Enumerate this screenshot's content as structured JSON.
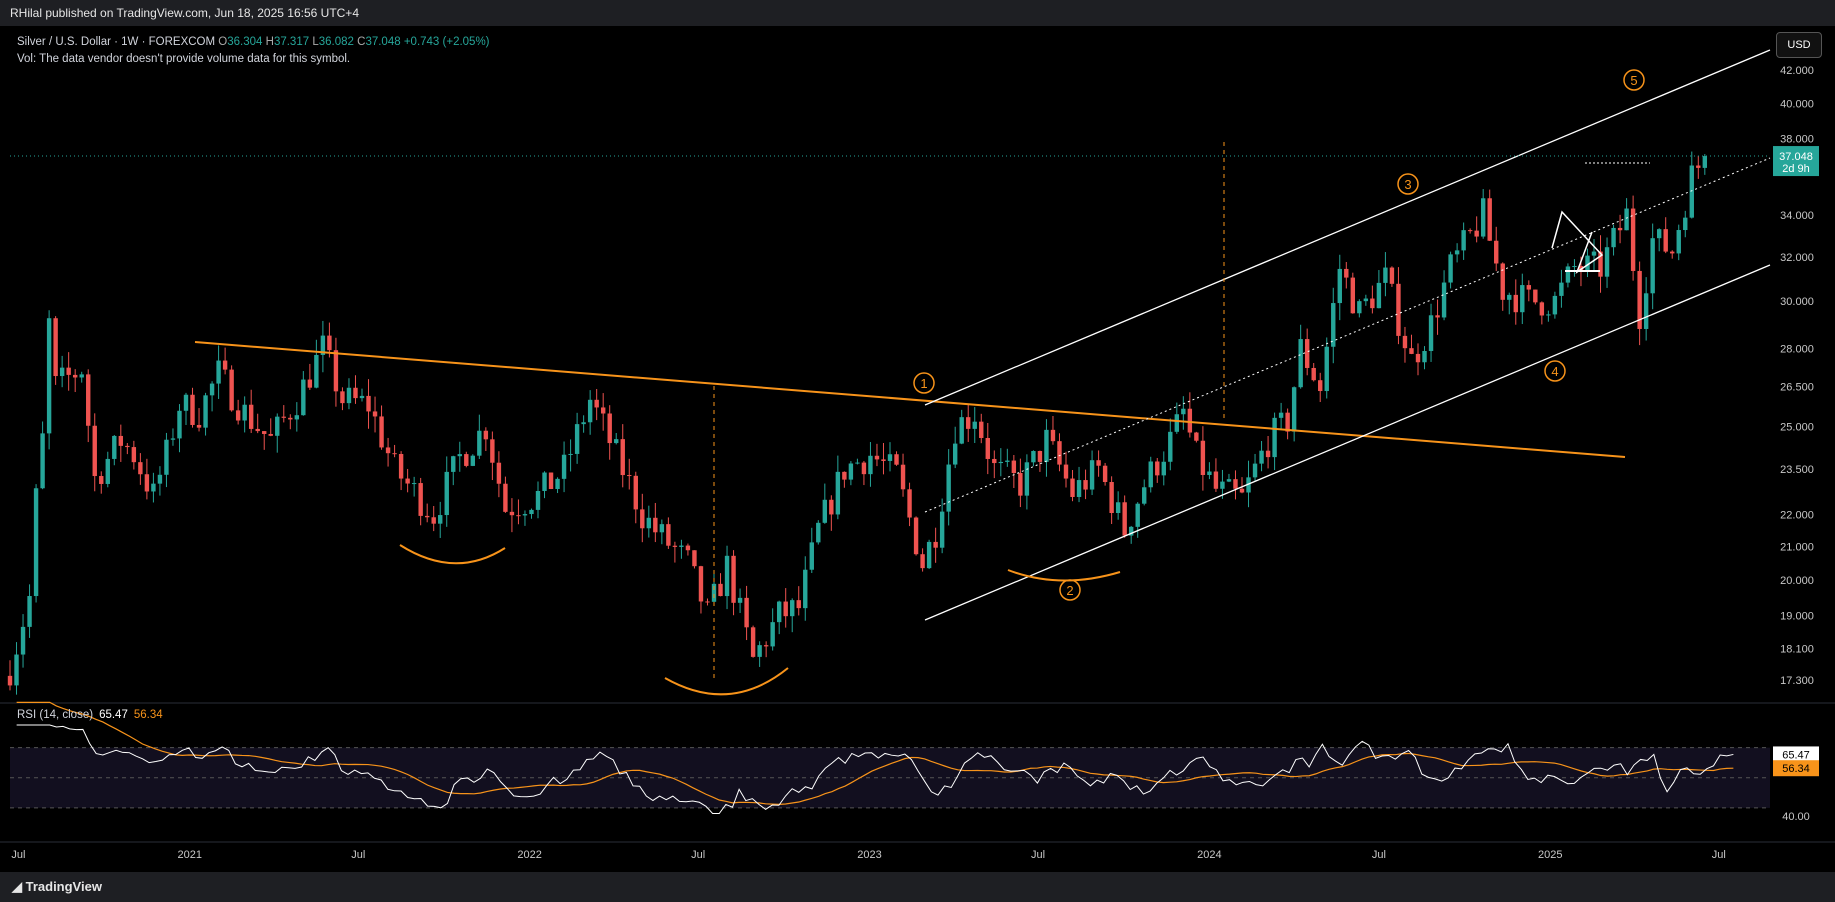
{
  "header": {
    "publisher": "RHilal published on TradingView.com, Jun 18, 2025 16:56 UTC+4"
  },
  "legend": {
    "title": "Silver / U.S. Dollar · 1W · FOREXCOM",
    "o_label": "O",
    "o": "36.304",
    "h_label": "H",
    "h": "37.317",
    "l_label": "L",
    "l": "36.082",
    "c_label": "C",
    "c": "37.048",
    "change": "+0.743 (+2.05%)",
    "vol_note": "Vol: The data vendor doesn't provide volume data for this symbol."
  },
  "currency_button": "USD",
  "last_price": {
    "value": "37.048",
    "countdown": "2d 9h"
  },
  "rsi": {
    "label": "RSI (14, close)",
    "value": "65.47",
    "ma": "56.34",
    "level_label": "40.00"
  },
  "footer": {
    "brand": "TradingView"
  },
  "colors": {
    "up": "#26a69a",
    "down": "#ef5350",
    "trendline": "#f7931a",
    "channel": "#ffffff",
    "rsi": "#ffffff",
    "rsi_ma": "#f7931a",
    "background": "#000000"
  },
  "chart_data": {
    "type": "candlestick",
    "symbol": "Silver / U.S. Dollar",
    "interval": "1W",
    "y_scale": "log",
    "ylim": [
      16.8,
      44.5
    ],
    "y_ticks": [
      "42.000",
      "40.000",
      "38.000",
      "34.000",
      "32.000",
      "30.000",
      "28.000",
      "26.500",
      "25.000",
      "23.500",
      "22.000",
      "21.000",
      "20.000",
      "19.000",
      "18.100",
      "17.300"
    ],
    "x_ticks": [
      "Jul",
      "2021",
      "Jul",
      "2022",
      "Jul",
      "2023",
      "Jul",
      "2024",
      "Jul",
      "2025",
      "Jul"
    ],
    "x_range": [
      "2020-06-22",
      "2025-08-25"
    ],
    "price_path": [
      [
        "2020-06-22",
        17.6
      ],
      [
        "2020-07-13",
        19.5
      ],
      [
        "2020-07-20",
        22.5
      ],
      [
        "2020-07-27",
        24.5
      ],
      [
        "2020-08-03",
        29.0
      ],
      [
        "2020-08-10",
        26.5
      ],
      [
        "2020-09-07",
        27.2
      ],
      [
        "2020-09-21",
        23.2
      ],
      [
        "2020-10-19",
        24.5
      ],
      [
        "2020-11-02",
        24.0
      ],
      [
        "2020-11-23",
        22.6
      ],
      [
        "2020-12-07",
        24.0
      ],
      [
        "2020-12-21",
        25.8
      ],
      [
        "2021-01-11",
        25.5
      ],
      [
        "2021-02-01",
        27.0
      ],
      [
        "2021-03-01",
        25.5
      ],
      [
        "2021-03-29",
        24.5
      ],
      [
        "2021-04-26",
        26.0
      ],
      [
        "2021-05-24",
        28.0
      ],
      [
        "2021-06-14",
        26.0
      ],
      [
        "2021-07-12",
        25.8
      ],
      [
        "2021-08-09",
        23.5
      ],
      [
        "2021-09-20",
        22.0
      ],
      [
        "2021-10-18",
        23.9
      ],
      [
        "2021-11-15",
        25.0
      ],
      [
        "2021-12-06",
        22.2
      ],
      [
        "2022-01-10",
        22.6
      ],
      [
        "2022-02-07",
        23.5
      ],
      [
        "2022-03-07",
        26.0
      ],
      [
        "2022-03-21",
        25.0
      ],
      [
        "2022-04-18",
        23.0
      ],
      [
        "2022-05-02",
        22.0
      ],
      [
        "2022-05-16",
        21.5
      ],
      [
        "2022-06-20",
        20.5
      ],
      [
        "2022-07-11",
        19.0
      ],
      [
        "2022-08-01",
        20.4
      ],
      [
        "2022-08-29",
        17.8
      ],
      [
        "2022-09-26",
        19.0
      ],
      [
        "2022-10-17",
        19.2
      ],
      [
        "2022-11-07",
        21.5
      ],
      [
        "2022-12-05",
        23.5
      ],
      [
        "2023-01-02",
        24.0
      ],
      [
        "2023-01-30",
        23.3
      ],
      [
        "2023-02-27",
        20.5
      ],
      [
        "2023-03-13",
        21.5
      ],
      [
        "2023-04-03",
        25.0
      ],
      [
        "2023-04-24",
        25.5
      ],
      [
        "2023-05-15",
        23.5
      ],
      [
        "2023-06-12",
        23.0
      ],
      [
        "2023-07-10",
        24.5
      ],
      [
        "2023-08-07",
        22.7
      ],
      [
        "2023-09-04",
        23.5
      ],
      [
        "2023-10-02",
        21.5
      ],
      [
        "2023-10-23",
        23.0
      ],
      [
        "2023-11-20",
        24.5
      ],
      [
        "2023-12-04",
        25.5
      ],
      [
        "2023-12-18",
        23.9
      ],
      [
        "2024-01-08",
        22.8
      ],
      [
        "2024-02-05",
        22.5
      ],
      [
        "2024-03-04",
        24.5
      ],
      [
        "2024-03-25",
        25.2
      ],
      [
        "2024-04-08",
        28.0
      ],
      [
        "2024-04-29",
        26.5
      ],
      [
        "2024-05-20",
        31.5
      ],
      [
        "2024-06-10",
        29.5
      ],
      [
        "2024-07-08",
        31.0
      ],
      [
        "2024-08-05",
        27.5
      ],
      [
        "2024-08-26",
        29.0
      ],
      [
        "2024-09-16",
        31.5
      ],
      [
        "2024-10-21",
        34.0
      ],
      [
        "2024-11-11",
        30.5
      ],
      [
        "2024-12-09",
        30.0
      ],
      [
        "2025-01-06",
        30.0
      ],
      [
        "2025-01-27",
        31.5
      ],
      [
        "2025-02-24",
        31.5
      ],
      [
        "2025-03-24",
        34.0
      ],
      [
        "2025-04-07",
        29.5
      ],
      [
        "2025-04-21",
        32.8
      ],
      [
        "2025-05-12",
        32.3
      ],
      [
        "2025-06-02",
        36.0
      ],
      [
        "2025-06-16",
        37.048
      ]
    ],
    "annotations": {
      "wave_labels": [
        "1",
        "2",
        "3",
        "4",
        "5"
      ],
      "lines": [
        "descending orange trendline",
        "ascending white channel",
        "dotted channel midline"
      ]
    },
    "rsi": {
      "levels": [
        70,
        50,
        30
      ],
      "last": 65.47,
      "ma_last": 56.34
    }
  }
}
